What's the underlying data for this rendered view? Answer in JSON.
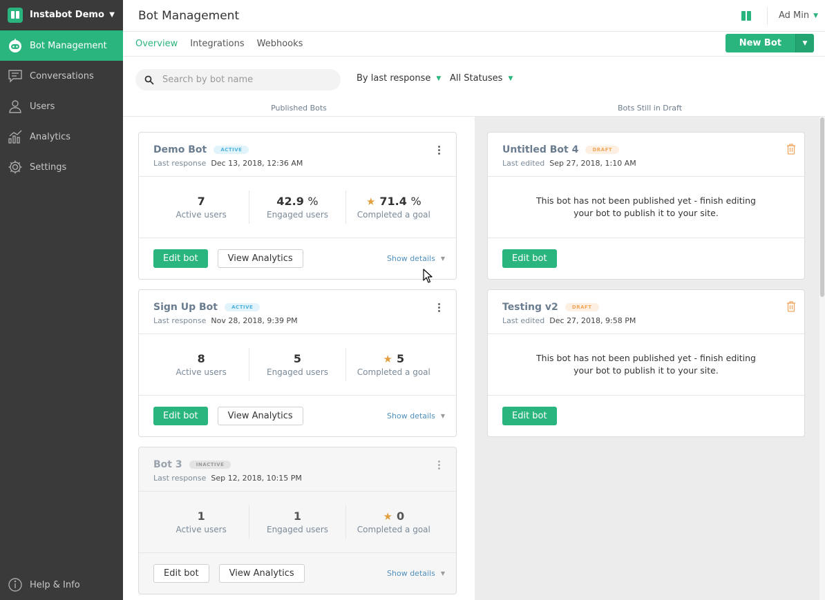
{
  "brand": {
    "name": "Instabot Demo"
  },
  "sidebar": {
    "items": [
      {
        "label": "Bot Management",
        "icon": "robot-icon"
      },
      {
        "label": "Conversations",
        "icon": "chat-icon"
      },
      {
        "label": "Users",
        "icon": "user-icon"
      },
      {
        "label": "Analytics",
        "icon": "analytics-icon"
      },
      {
        "label": "Settings",
        "icon": "gear-icon"
      }
    ],
    "help": "Help & Info"
  },
  "header": {
    "title": "Bot Management",
    "user": "Ad Min"
  },
  "tabs": [
    {
      "label": "Overview"
    },
    {
      "label": "Integrations"
    },
    {
      "label": "Webhooks"
    }
  ],
  "new_bot_label": "New Bot",
  "search": {
    "placeholder": "Search by bot name",
    "value": ""
  },
  "filters": {
    "sort": "By last response",
    "status": "All Statuses"
  },
  "columns": {
    "published": "Published Bots",
    "draft": "Bots Still in Draft"
  },
  "published_bots": [
    {
      "name": "Demo Bot",
      "badge": "ACTIVE",
      "meta_label": "Last response",
      "meta_value": "Dec 13, 2018, 12:36 AM",
      "active_users": "7",
      "engaged": "42.9",
      "engaged_unit": "%",
      "completed": "71.4",
      "completed_unit": "%",
      "active_label": "Active users",
      "engaged_label": "Engaged users",
      "completed_label": "Completed a goal",
      "edit_label": "Edit bot",
      "analytics_label": "View Analytics",
      "details_label": "Show details"
    },
    {
      "name": "Sign Up Bot",
      "badge": "ACTIVE",
      "meta_label": "Last response",
      "meta_value": "Nov 28, 2018, 9:39 PM",
      "active_users": "8",
      "engaged": "5",
      "engaged_unit": "",
      "completed": "5",
      "completed_unit": "",
      "active_label": "Active users",
      "engaged_label": "Engaged users",
      "completed_label": "Completed a goal",
      "edit_label": "Edit bot",
      "analytics_label": "View Analytics",
      "details_label": "Show details"
    },
    {
      "name": "Bot 3",
      "badge": "INACTIVE",
      "meta_label": "Last response",
      "meta_value": "Sep 12, 2018, 10:15 PM",
      "active_users": "1",
      "engaged": "1",
      "engaged_unit": "",
      "completed": "0",
      "completed_unit": "",
      "active_label": "Active users",
      "engaged_label": "Engaged users",
      "completed_label": "Completed a goal",
      "edit_label": "Edit bot",
      "analytics_label": "View Analytics",
      "details_label": "Show details"
    }
  ],
  "draft_bots": [
    {
      "name": "Untitled Bot 4",
      "badge": "DRAFT",
      "meta_label": "Last edited",
      "meta_value": "Sep 27, 2018, 1:10 AM",
      "message": "This bot has not been published yet - finish editing your bot to publish it to your site.",
      "edit_label": "Edit bot"
    },
    {
      "name": "Testing v2",
      "badge": "DRAFT",
      "meta_label": "Last edited",
      "meta_value": "Dec 27, 2018, 9:58 PM",
      "message": "This bot has not been published yet - finish editing your bot to publish it to your site.",
      "edit_label": "Edit bot"
    }
  ],
  "colors": {
    "accent": "#2bb57e",
    "sidebar": "#3a3a3a",
    "star": "#e0a040",
    "link": "#4f8fbd"
  }
}
